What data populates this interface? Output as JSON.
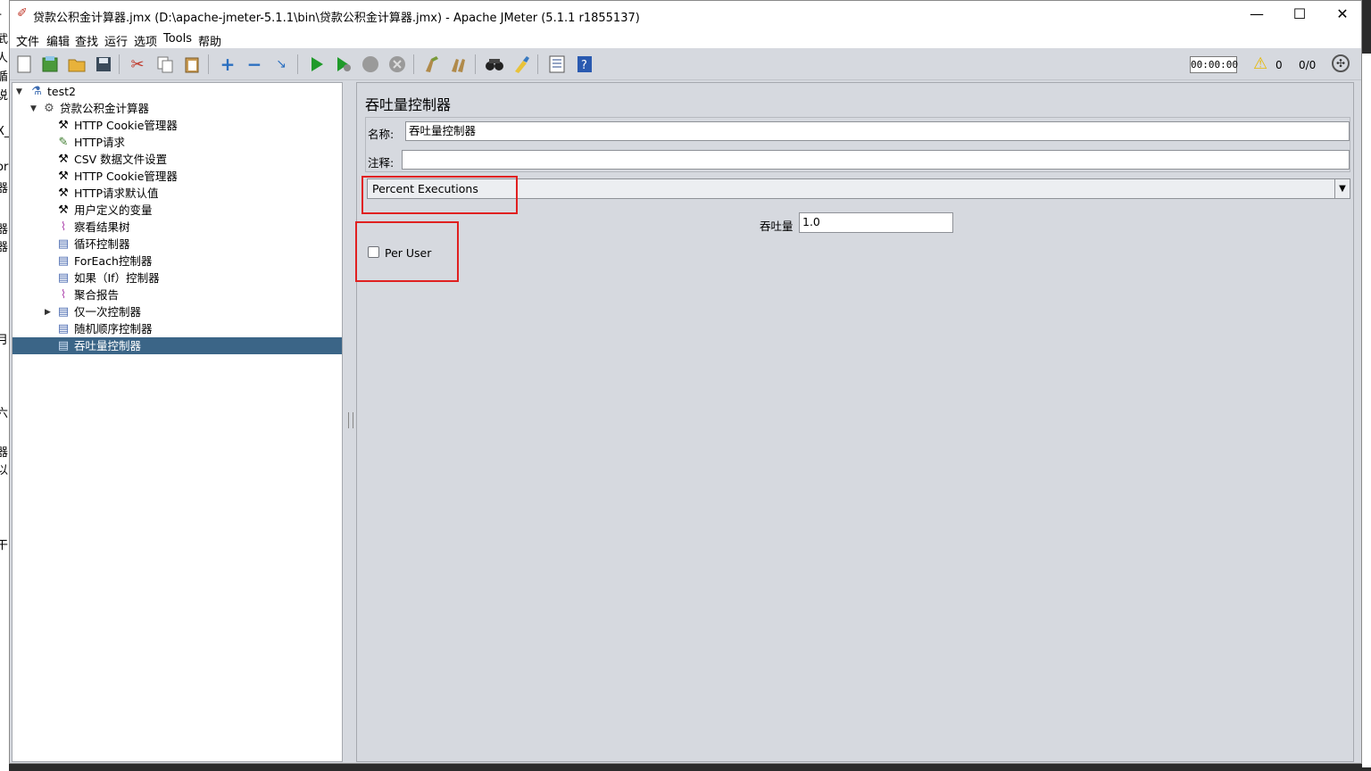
{
  "window": {
    "title": "贷款公积金计算器.jmx (D:\\apache-jmeter-5.1.1\\bin\\贷款公积金计算器.jmx) - Apache JMeter (5.1.1 r1855137)",
    "minimize": "—",
    "maximize": "☐",
    "close": "✕"
  },
  "menu": [
    "文件",
    "编辑",
    "查找",
    "运行",
    "选项",
    "Tools",
    "帮助"
  ],
  "toolbar": {
    "timer": "00:00:00",
    "warning_count": "0",
    "threads": "0/0"
  },
  "tree": {
    "root": "test2",
    "plan": "贷款公积金计算器",
    "children": [
      {
        "label": "HTTP Cookie管理器",
        "icon": "wrench-icon"
      },
      {
        "label": "HTTP请求",
        "icon": "pipette-icon"
      },
      {
        "label": "CSV 数据文件设置",
        "icon": "wrench-icon"
      },
      {
        "label": "HTTP Cookie管理器",
        "icon": "wrench-icon"
      },
      {
        "label": "HTTP请求默认值",
        "icon": "wrench-icon"
      },
      {
        "label": "用户定义的变量",
        "icon": "wrench-icon"
      },
      {
        "label": "察看结果树",
        "icon": "chart-icon"
      },
      {
        "label": "循环控制器",
        "icon": "controller-icon"
      },
      {
        "label": "ForEach控制器",
        "icon": "controller-icon"
      },
      {
        "label": "如果（If）控制器",
        "icon": "controller-icon"
      },
      {
        "label": "聚合报告",
        "icon": "chart-icon"
      },
      {
        "label": "仅一次控制器",
        "icon": "controller-icon"
      },
      {
        "label": "随机顺序控制器",
        "icon": "controller-icon"
      },
      {
        "label": "吞吐量控制器",
        "icon": "controller-icon"
      }
    ],
    "selected_index": 13
  },
  "panel": {
    "title": "吞吐量控制器",
    "name_label": "名称:",
    "name_value": "吞吐量控制器",
    "comment_label": "注释:",
    "comment_value": "",
    "mode_selected": "Percent Executions",
    "throughput_label": "吞吐量",
    "throughput_value": "1.0",
    "per_user_label": "Per User",
    "per_user_checked": false
  },
  "accent_colors": {
    "selection": "#3b6587",
    "highlight_box": "#e02020"
  }
}
